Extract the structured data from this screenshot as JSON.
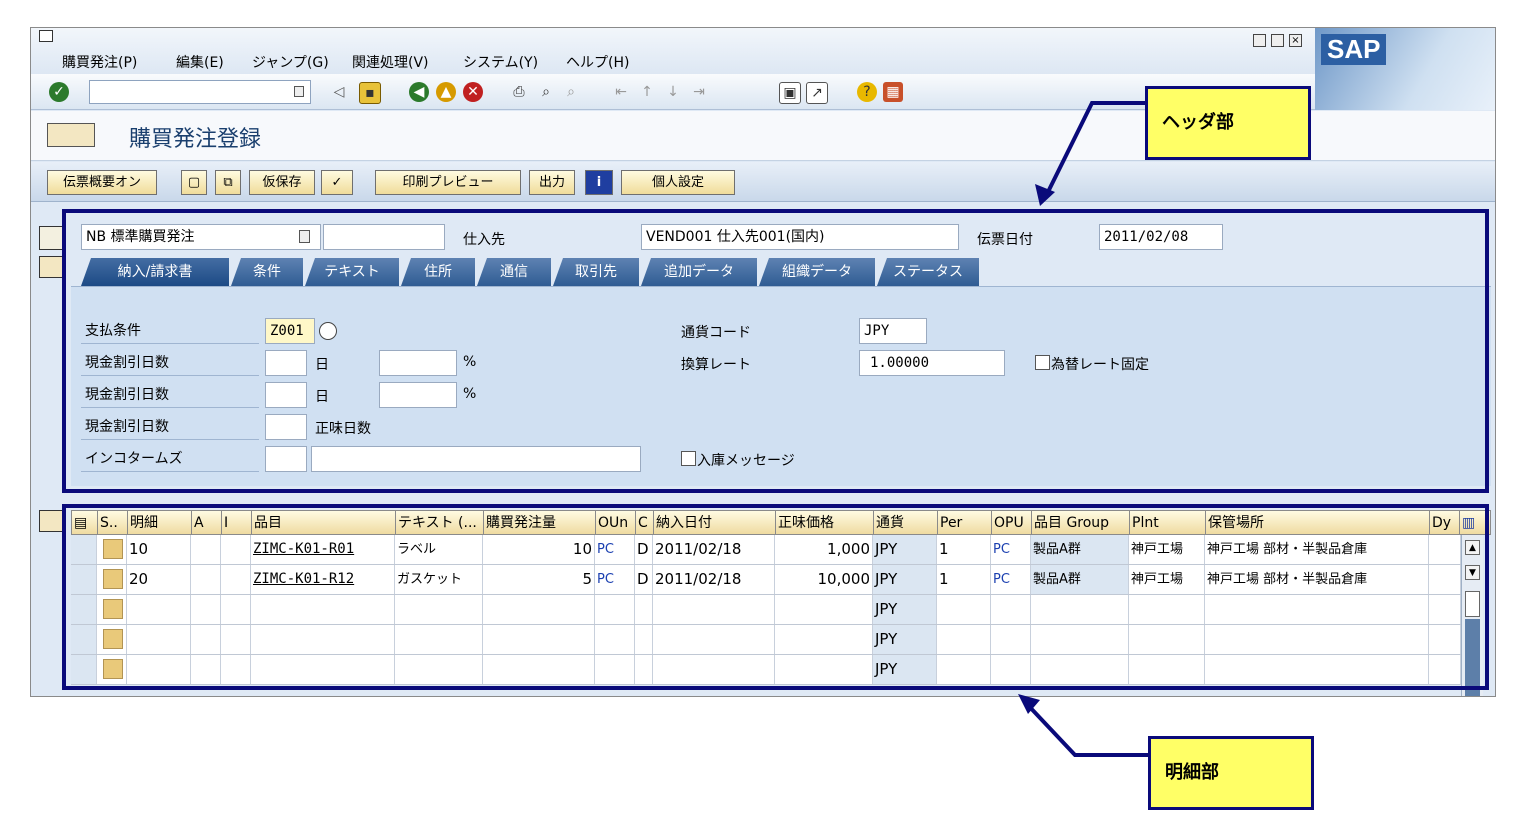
{
  "menu": [
    "購買発注(P)",
    "編集(E)",
    "ジャンプ(G)",
    "関連処理(V)",
    "システム(Y)",
    "ヘルプ(H)"
  ],
  "brand": "SAP",
  "toolbar": {
    "command_field": "",
    "icons": [
      "enter-icon",
      "back-icon",
      "save-icon",
      "green-back-icon",
      "exit-icon",
      "cancel-icon",
      "print-icon",
      "find-icon",
      "find-next-icon",
      "first-page-icon",
      "prev-page-icon",
      "next-page-icon",
      "last-page-icon",
      "new-session-icon",
      "shortcut-icon",
      "help-icon",
      "layout-icon"
    ]
  },
  "title": "購買発注登録",
  "app_toolbar": {
    "doc_overview": "伝票概要オン",
    "hold": "仮保存",
    "print_preview": "印刷プレビュー",
    "output": "出力",
    "personal_setting": "個人設定"
  },
  "header": {
    "doc_type": "NB 標準購買発注",
    "doc_type_extra": "",
    "vendor_label": "仕入先",
    "vendor_value": "VEND001 仕入先001(国内)",
    "date_label": "伝票日付",
    "date_value": "2011/02/08"
  },
  "tabs": [
    "納入/請求書",
    "条件",
    "テキスト",
    "住所",
    "通信",
    "取引先",
    "追加データ",
    "組織データ",
    "ステータス"
  ],
  "tab_content": {
    "payment_terms_label": "支払条件",
    "payment_terms_value": "Z001",
    "cash_discount_label": "現金割引日数",
    "day_unit": "日",
    "percent": "%",
    "net_days": "正味日数",
    "incoterms_label": "インコタームズ",
    "currency_label": "通貨コード",
    "currency_value": "JPY",
    "exchange_rate_label": "換算レート",
    "exchange_rate_value": "1.00000",
    "fixed_rate_label": "為替レート固定",
    "gr_message_label": "入庫メッセージ"
  },
  "items_table": {
    "columns": [
      "S..",
      "明細",
      "A",
      "I",
      "品目",
      "テキスト (...",
      "購買発注量",
      "OUn",
      "C",
      "納入日付",
      "正味価格",
      "通貨",
      "Per",
      "OPU",
      "品目 Group",
      "Plnt",
      "保管場所",
      "Dy"
    ],
    "rows": [
      {
        "item": "10",
        "material": "ZIMC-K01-R01",
        "text": "ラベル",
        "qty": "10",
        "oun": "PC",
        "c": "D",
        "date": "2011/02/18",
        "price": "1,000",
        "curr": "JPY",
        "per": "1",
        "opu": "PC",
        "group": "製品A群",
        "plant": "神戸工場",
        "sloc": "神戸工場 部材・半製品倉庫"
      },
      {
        "item": "20",
        "material": "ZIMC-K01-R12",
        "text": "ガスケット",
        "qty": "5",
        "oun": "PC",
        "c": "D",
        "date": "2011/02/18",
        "price": "10,000",
        "curr": "JPY",
        "per": "1",
        "opu": "PC",
        "group": "製品A群",
        "plant": "神戸工場",
        "sloc": "神戸工場 部材・半製品倉庫"
      },
      {
        "item": "",
        "material": "",
        "text": "",
        "qty": "",
        "oun": "",
        "c": "",
        "date": "",
        "price": "",
        "curr": "JPY",
        "per": "",
        "opu": "",
        "group": "",
        "plant": "",
        "sloc": ""
      },
      {
        "item": "",
        "material": "",
        "text": "",
        "qty": "",
        "oun": "",
        "c": "",
        "date": "",
        "price": "",
        "curr": "JPY",
        "per": "",
        "opu": "",
        "group": "",
        "plant": "",
        "sloc": ""
      },
      {
        "item": "",
        "material": "",
        "text": "",
        "qty": "",
        "oun": "",
        "c": "",
        "date": "",
        "price": "",
        "curr": "JPY",
        "per": "",
        "opu": "",
        "group": "",
        "plant": "",
        "sloc": ""
      }
    ]
  },
  "callouts": {
    "header_label": "ヘッダ部",
    "item_label": "明細部",
    "color": "#ffff66",
    "border_color": "#0a0a7a"
  }
}
